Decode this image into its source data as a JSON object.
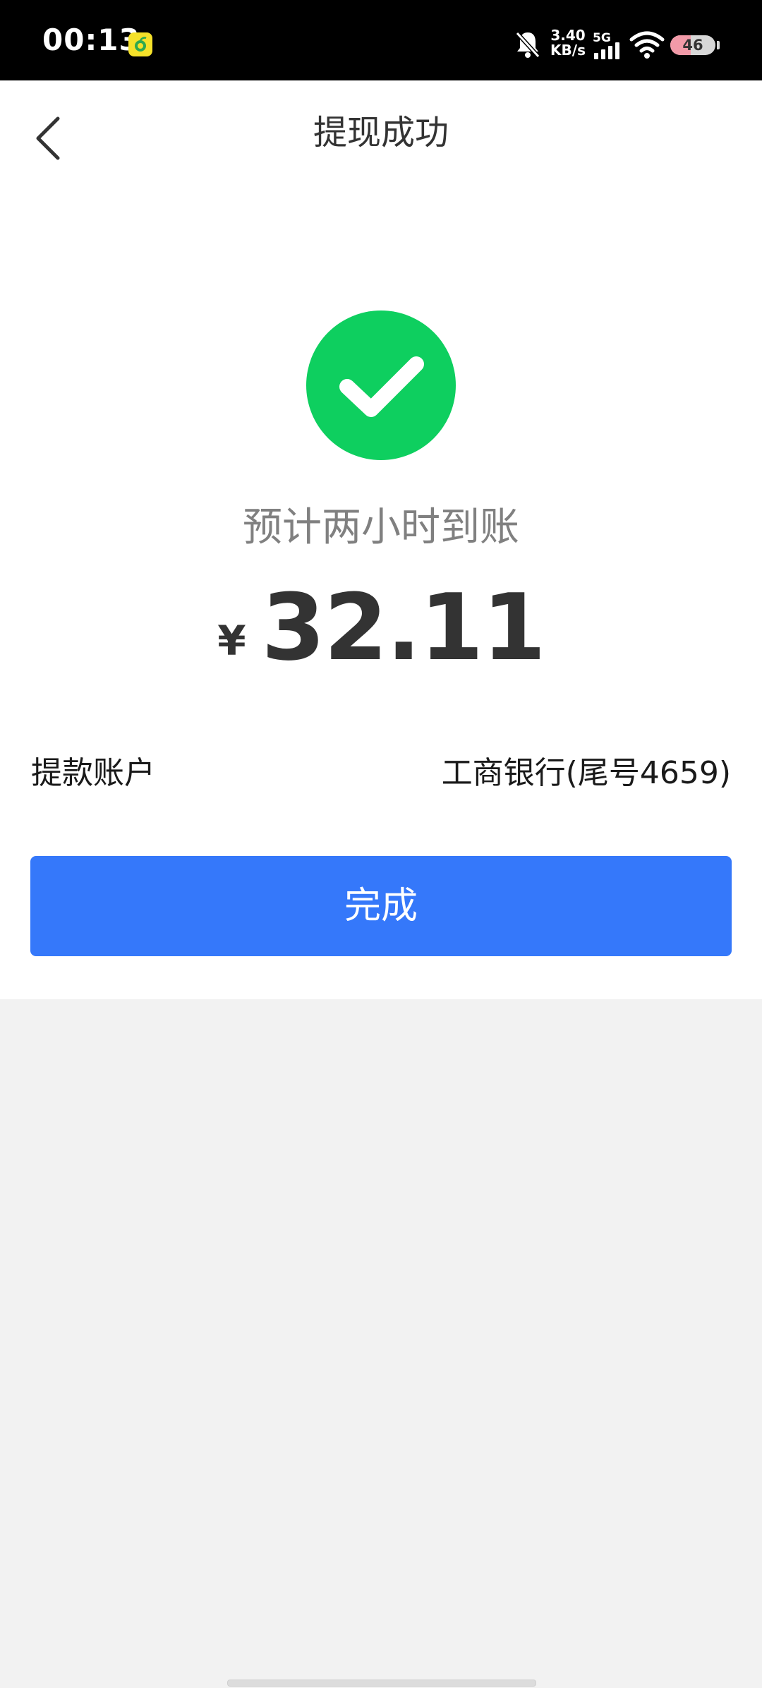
{
  "status_bar": {
    "time": "00:13",
    "net_speed_value": "3.40",
    "net_speed_unit": "KB/s",
    "network_type": "5G",
    "battery_level": "46",
    "battery_fraction": 0.46,
    "icons": [
      "app-notification-icon",
      "mute-bell-icon",
      "signal-icon",
      "wifi-icon",
      "battery-icon"
    ]
  },
  "header": {
    "title": "提现成功",
    "back_icon": "chevron-left-icon"
  },
  "result": {
    "icon": "check-circle-icon",
    "eta": "预计两小时到账",
    "currency_symbol": "¥",
    "amount": "32.11"
  },
  "account": {
    "label": "提款账户",
    "value": "工商银行(尾号4659)"
  },
  "actions": {
    "done_label": "完成"
  },
  "colors": {
    "success": "#0ecf5f",
    "primary_button": "#3578fa",
    "background": "#f2f2f2",
    "card": "#ffffff"
  }
}
